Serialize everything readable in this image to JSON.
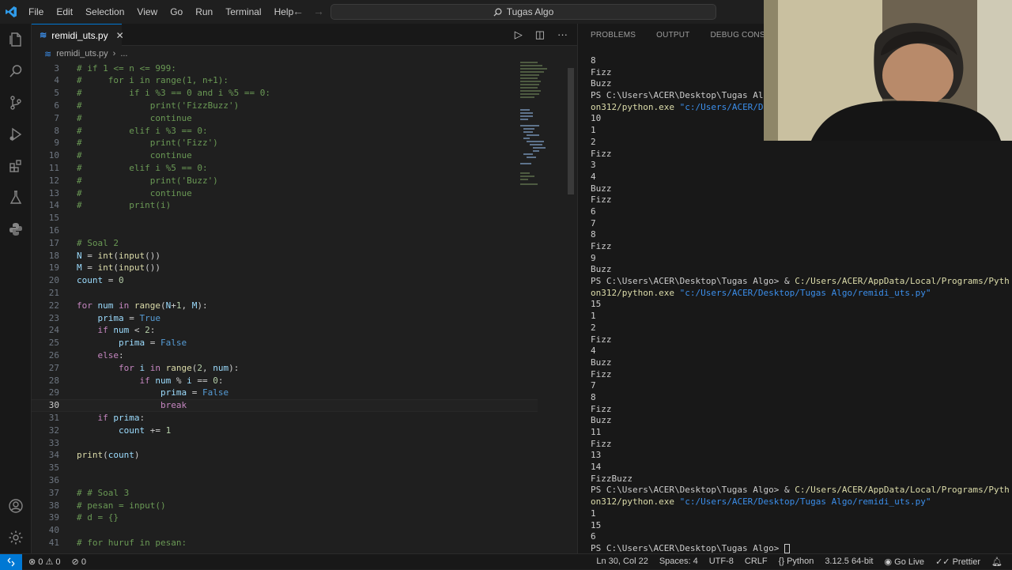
{
  "menu": [
    "File",
    "Edit",
    "Selection",
    "View",
    "Go",
    "Run",
    "Terminal",
    "Help"
  ],
  "search": "Tugas Algo",
  "tab": {
    "title": "remidi_uts.py",
    "close": "✕"
  },
  "breadcrumb": [
    "remidi_uts.py",
    "›",
    "..."
  ],
  "editor_lines": [
    {
      "n": "3",
      "t": "# if 1 <= n <= 999:"
    },
    {
      "n": "4",
      "t": "#     for i in range(1, n+1):"
    },
    {
      "n": "5",
      "t": "#         if i %3 == 0 and i %5 == 0:"
    },
    {
      "n": "6",
      "t": "#             print('FizzBuzz')"
    },
    {
      "n": "7",
      "t": "#             continue"
    },
    {
      "n": "8",
      "t": "#         elif i %3 == 0:"
    },
    {
      "n": "9",
      "t": "#             print('Fizz')"
    },
    {
      "n": "10",
      "t": "#             continue"
    },
    {
      "n": "11",
      "t": "#         elif i %5 == 0:"
    },
    {
      "n": "12",
      "t": "#             print('Buzz')"
    },
    {
      "n": "13",
      "t": "#             continue"
    },
    {
      "n": "14",
      "t": "#         print(i)"
    },
    {
      "n": "15",
      "t": ""
    },
    {
      "n": "16",
      "t": ""
    },
    {
      "n": "17",
      "t": "# Soal 2"
    },
    {
      "n": "18",
      "t": "N = int(input())"
    },
    {
      "n": "19",
      "t": "M = int(input())"
    },
    {
      "n": "20",
      "t": "count = 0"
    },
    {
      "n": "21",
      "t": ""
    },
    {
      "n": "22",
      "t": "for num in range(N+1, M):"
    },
    {
      "n": "23",
      "t": "    prima = True"
    },
    {
      "n": "24",
      "t": "    if num < 2:"
    },
    {
      "n": "25",
      "t": "        prima = False"
    },
    {
      "n": "26",
      "t": "    else:"
    },
    {
      "n": "27",
      "t": "        for i in range(2, num):"
    },
    {
      "n": "28",
      "t": "            if num % i == 0:"
    },
    {
      "n": "29",
      "t": "                prima = False"
    },
    {
      "n": "30",
      "t": "                break"
    },
    {
      "n": "31",
      "t": "    if prima:"
    },
    {
      "n": "32",
      "t": "        count += 1"
    },
    {
      "n": "33",
      "t": ""
    },
    {
      "n": "34",
      "t": "print(count)"
    },
    {
      "n": "35",
      "t": ""
    },
    {
      "n": "36",
      "t": ""
    },
    {
      "n": "37",
      "t": "# # Soal 3"
    },
    {
      "n": "38",
      "t": "# pesan = input()"
    },
    {
      "n": "39",
      "t": "# d = {}"
    },
    {
      "n": "40",
      "t": ""
    },
    {
      "n": "41",
      "t": "# for huruf in pesan:"
    }
  ],
  "panel_tabs": [
    "PROBLEMS",
    "OUTPUT",
    "DEBUG CONSOLE",
    "TE"
  ],
  "terminal_lines": [
    "8",
    "Fizz",
    "Buzz",
    "PS C:\\Users\\ACER\\Desktop\\Tugas Algo>",
    "on312/python.exe \"c:/Users/ACER/Deskt",
    "10",
    "1",
    "2",
    "Fizz",
    "3",
    "4",
    "Buzz",
    "Fizz",
    "6",
    "7",
    "8",
    "Fizz",
    "9",
    "Buzz",
    "PS C:\\Users\\ACER\\Desktop\\Tugas Algo> & C:/Users/ACER/AppData/Local/Programs/Python/Pyth",
    "on312/python.exe \"c:/Users/ACER/Desktop/Tugas Algo/remidi_uts.py\"",
    "15",
    "1",
    "2",
    "Fizz",
    "4",
    "Buzz",
    "Fizz",
    "7",
    "8",
    "Fizz",
    "Buzz",
    "11",
    "Fizz",
    "13",
    "14",
    "FizzBuzz",
    "PS C:\\Users\\ACER\\Desktop\\Tugas Algo> & C:/Users/ACER/AppData/Local/Programs/Python/Pyth",
    "on312/python.exe \"c:/Users/ACER/Desktop/Tugas Algo/remidi_uts.py\"",
    "1",
    "15",
    "6",
    "PS C:\\Users\\ACER\\Desktop\\Tugas Algo> "
  ],
  "status": {
    "errors": "0",
    "warnings": "0",
    "ports": "0",
    "position": "Ln 30, Col 22",
    "spaces": "Spaces: 4",
    "encoding": "UTF-8",
    "eol": "CRLF",
    "language": "Python",
    "interpreter": "3.12.5 64-bit",
    "golive": "Go Live",
    "prettier": "Prettier"
  },
  "colors": {
    "comment": "#6a9955",
    "keyword": "#c586c0",
    "builtin": "#dcdcaa",
    "variable": "#9cdcfe",
    "const": "#569cd6",
    "number": "#b5cea8",
    "string": "#ce9178",
    "accent": "#0078d4"
  }
}
